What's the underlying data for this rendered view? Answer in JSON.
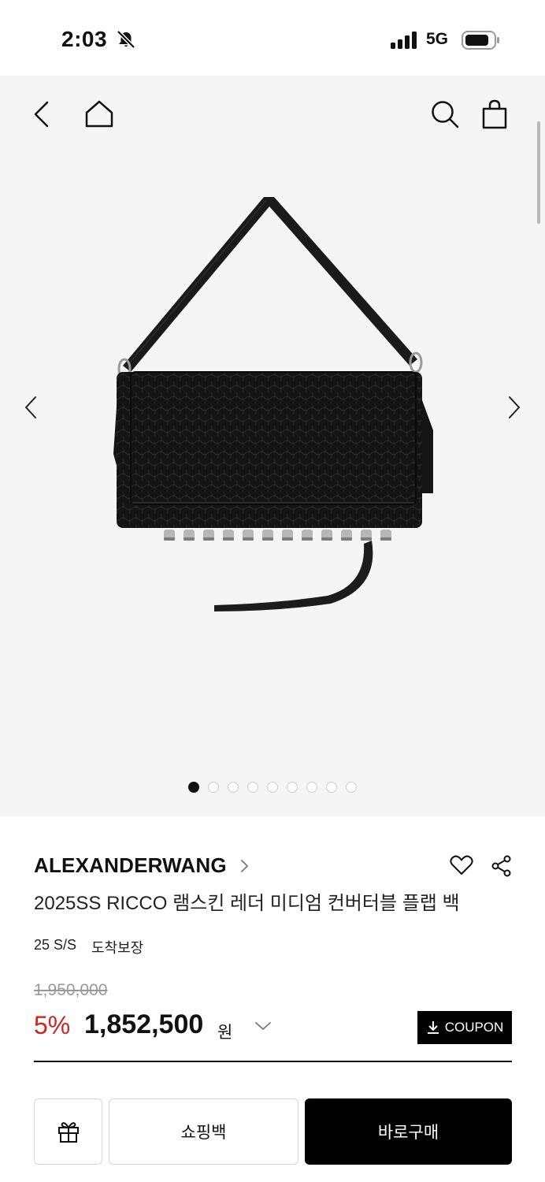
{
  "status_bar": {
    "time": "2:03",
    "network": "5G"
  },
  "product": {
    "brand": "ALEXANDERWANG",
    "title": "2025SS RICCO 램스킨 레더 미디엄 컨버터블 플랩 백",
    "season": "25 S/S",
    "delivery": "도착보장",
    "original_price": "1,950,000",
    "discount_rate": "5%",
    "sale_price": "1,852,500",
    "price_unit": "원",
    "coupon_label": "COUPON"
  },
  "gallery": {
    "total_images": 9,
    "active_index": 1
  },
  "actions": {
    "cart_label": "쇼핑백",
    "buy_label": "바로구매"
  },
  "colors": {
    "accent": "#d0231f",
    "primary": "#000000",
    "gallery_bg": "#f5f5f5"
  },
  "icons": [
    "back-icon",
    "home-icon",
    "search-icon",
    "shopping-bag-icon",
    "heart-icon",
    "share-icon",
    "gift-icon",
    "download-icon"
  ]
}
